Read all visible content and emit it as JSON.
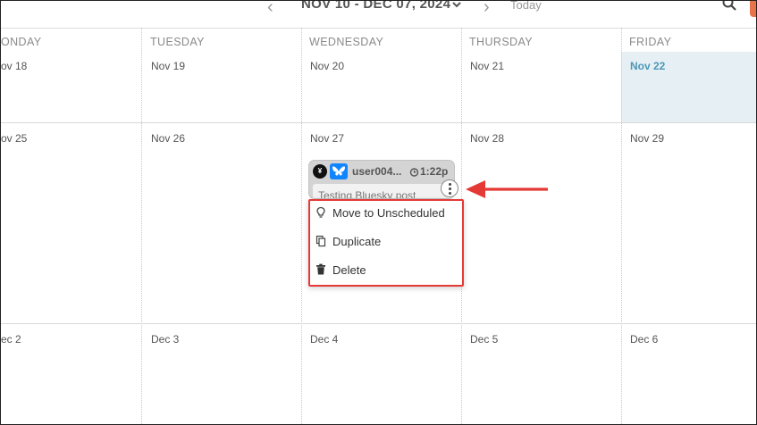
{
  "header": {
    "date_range": "NOV 10 - DEC 07, 2024",
    "today_label": "Today"
  },
  "calendar": {
    "weekdays": [
      "ONDAY",
      "TUESDAY",
      "WEDNESDAY",
      "THURSDAY",
      "FRIDAY"
    ],
    "weeks": [
      [
        "ov 18",
        "Nov 19",
        "Nov 20",
        "Nov 21",
        "Nov 22"
      ],
      [
        "ov 25",
        "Nov 26",
        "Nov 27",
        "Nov 28",
        "Nov 29"
      ],
      [
        "ec 2",
        "Dec 3",
        "Dec 4",
        "Dec 5",
        "Dec 6"
      ]
    ],
    "today_index": [
      0,
      4
    ]
  },
  "event": {
    "avatar_letter": "¥",
    "username": "user004...",
    "time": "1:22p",
    "preview": "Testing Bluesky post"
  },
  "context_menu": {
    "items": [
      {
        "label": "Move to Unscheduled",
        "icon": "lightbulb-icon"
      },
      {
        "label": "Duplicate",
        "icon": "copy-icon"
      },
      {
        "label": "Delete",
        "icon": "trash-icon"
      }
    ]
  },
  "colors": {
    "today_bg": "#e6eff3",
    "today_text": "#4d97b8",
    "bluesky": "#1185fe",
    "highlight": "#e53935"
  }
}
